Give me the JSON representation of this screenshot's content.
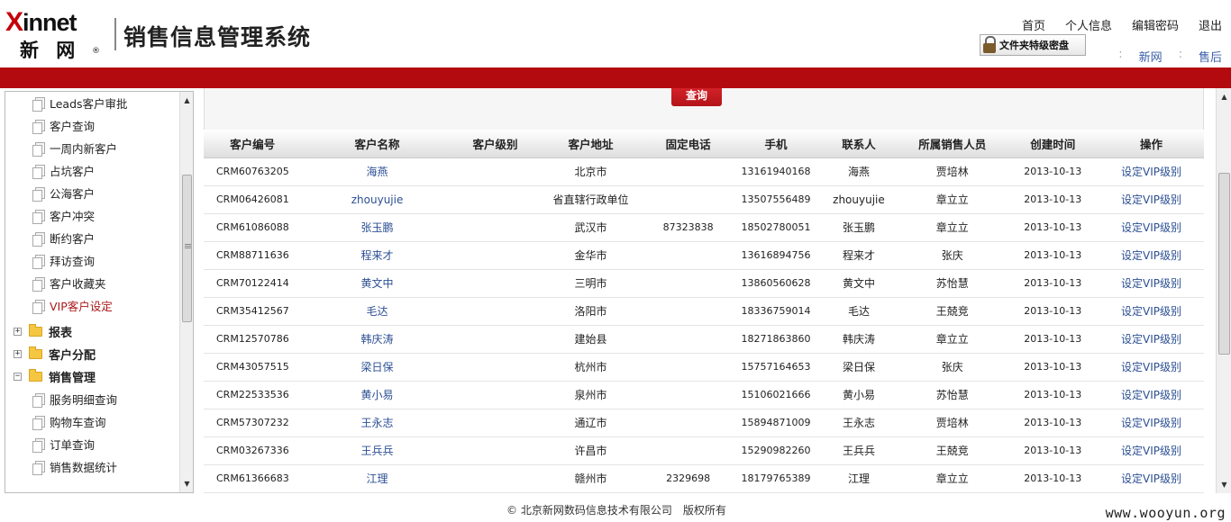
{
  "header": {
    "logo_text": "xinnet",
    "logo_cn": "新 网",
    "logo_reg": "®",
    "system_title": "销售信息管理系统",
    "nav": [
      "首页",
      "个人信息",
      "编辑密码",
      "退出"
    ],
    "folder_badge": "文件夹特级密盘",
    "subnav": [
      "新网",
      "售后"
    ]
  },
  "sidebar": {
    "items": [
      {
        "label": "Leads客户审批",
        "type": "sub",
        "icon": "page-icon"
      },
      {
        "label": "客户查询",
        "type": "sub",
        "icon": "page-icon"
      },
      {
        "label": "一周内新客户",
        "type": "sub",
        "icon": "page-icon"
      },
      {
        "label": "占坑客户",
        "type": "sub",
        "icon": "page-icon"
      },
      {
        "label": "公海客户",
        "type": "sub",
        "icon": "page-icon"
      },
      {
        "label": "客户冲突",
        "type": "sub",
        "icon": "page-icon"
      },
      {
        "label": "断约客户",
        "type": "sub",
        "icon": "page-icon"
      },
      {
        "label": "拜访查询",
        "type": "sub",
        "icon": "page-icon"
      },
      {
        "label": "客户收藏夹",
        "type": "sub",
        "icon": "page-icon"
      },
      {
        "label": "VIP客户设定",
        "type": "sub",
        "icon": "page-icon",
        "active": true
      },
      {
        "label": "报表",
        "type": "group",
        "icon": "folder-icon",
        "toggle": "+"
      },
      {
        "label": "客户分配",
        "type": "group",
        "icon": "folder-icon",
        "toggle": "+"
      },
      {
        "label": "销售管理",
        "type": "group",
        "icon": "folder-icon",
        "toggle": "−"
      },
      {
        "label": "服务明细查询",
        "type": "sub",
        "icon": "page-icon"
      },
      {
        "label": "购物车查询",
        "type": "sub",
        "icon": "page-icon"
      },
      {
        "label": "订单查询",
        "type": "sub",
        "icon": "page-icon"
      },
      {
        "label": "销售数据统计",
        "type": "sub",
        "icon": "page-icon"
      }
    ]
  },
  "main": {
    "query_button": "查询",
    "columns": [
      "客户编号",
      "客户名称",
      "客户级别",
      "客户地址",
      "固定电话",
      "手机",
      "联系人",
      "所属销售人员",
      "创建时间",
      "操作"
    ],
    "rows": [
      [
        "CRM60763205",
        "海燕",
        "",
        "北京市",
        "",
        "13161940168",
        "海燕",
        "贾培林",
        "2013-10-13",
        "设定VIP级别"
      ],
      [
        "CRM06426081",
        "zhouyujie",
        "",
        "省直辖行政单位",
        "",
        "13507556489",
        "zhouyujie",
        "章立立",
        "2013-10-13",
        "设定VIP级别"
      ],
      [
        "CRM61086088",
        "张玉鹏",
        "",
        "武汉市",
        "87323838",
        "18502780051",
        "张玉鹏",
        "章立立",
        "2013-10-13",
        "设定VIP级别"
      ],
      [
        "CRM88711636",
        "程来才",
        "",
        "金华市",
        "",
        "13616894756",
        "程来才",
        "张庆",
        "2013-10-13",
        "设定VIP级别"
      ],
      [
        "CRM70122414",
        "黄文中",
        "",
        "三明市",
        "",
        "13860560628",
        "黄文中",
        "苏怡慧",
        "2013-10-13",
        "设定VIP级别"
      ],
      [
        "CRM35412567",
        "毛达",
        "",
        "洛阳市",
        "",
        "18336759014",
        "毛达",
        "王兢竞",
        "2013-10-13",
        "设定VIP级别"
      ],
      [
        "CRM12570786",
        "韩庆涛",
        "",
        "建始县",
        "",
        "18271863860",
        "韩庆涛",
        "章立立",
        "2013-10-13",
        "设定VIP级别"
      ],
      [
        "CRM43057515",
        "梁日保",
        "",
        "杭州市",
        "",
        "15757164653",
        "梁日保",
        "张庆",
        "2013-10-13",
        "设定VIP级别"
      ],
      [
        "CRM22533536",
        "黄小易",
        "",
        "泉州市",
        "",
        "15106021666",
        "黄小易",
        "苏怡慧",
        "2013-10-13",
        "设定VIP级别"
      ],
      [
        "CRM57307232",
        "王永志",
        "",
        "通辽市",
        "",
        "15894871009",
        "王永志",
        "贾培林",
        "2013-10-13",
        "设定VIP级别"
      ],
      [
        "CRM03267336",
        "王兵兵",
        "",
        "许昌市",
        "",
        "15290982260",
        "王兵兵",
        "王兢竞",
        "2013-10-13",
        "设定VIP级别"
      ],
      [
        "CRM61366683",
        "江理",
        "",
        "赣州市",
        "2329698",
        "18179765389",
        "江理",
        "章立立",
        "2013-10-13",
        "设定VIP级别"
      ]
    ]
  },
  "footer": {
    "copyright": "© 北京新网数码信息技术有限公司　版权所有",
    "watermark": "www.wooyun.org"
  }
}
